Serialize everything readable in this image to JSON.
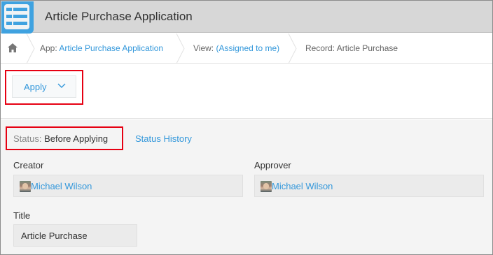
{
  "header": {
    "app_title": "Article Purchase Application",
    "accent": "#3fa2e0"
  },
  "breadcrumb": {
    "home_icon": "home-icon",
    "app_prefix": "App: ",
    "app_name": "Article Purchase Application",
    "view_prefix": "View: ",
    "view_name": "(Assigned to me)",
    "record": "Record: Article Purchase"
  },
  "toolbar": {
    "apply_label": "Apply",
    "apply_icon": "chevron-down-icon"
  },
  "status": {
    "label": "Status:",
    "value": "Before Applying",
    "history_link": "Status History"
  },
  "fields": {
    "creator": {
      "label": "Creator",
      "user": "Michael Wilson"
    },
    "approver": {
      "label": "Approver",
      "user": "Michael Wilson"
    },
    "title": {
      "label": "Title",
      "value": "Article Purchase"
    }
  },
  "highlight_color": "#e60012",
  "link_color": "#3498db"
}
